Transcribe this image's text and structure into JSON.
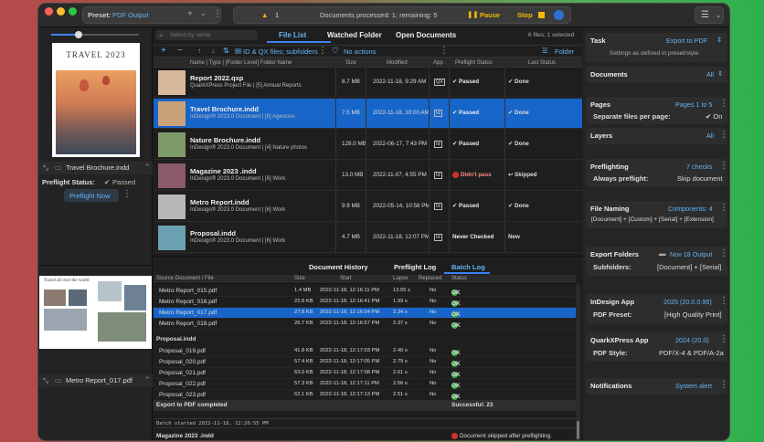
{
  "toolbar": {
    "preset_label": "Preset:",
    "preset_value": "PDF Output",
    "warning_count": "1",
    "status": "Documents processed: 1; remaining: 5",
    "pause": "Pause",
    "stop": "Stop"
  },
  "left": {
    "doc1": "Travel Brochure.indd",
    "thumb_title": "TRAVEL 2023",
    "preflight_label": "Preflight Status:",
    "preflight_value": "Passed",
    "preflight_now": "Preflight Now",
    "doc2": "Metro Report_017.pdf",
    "thumb2_title": "Travel all over the world"
  },
  "tabs": {
    "file_list": "File List",
    "watched": "Watched Folder",
    "open_docs": "Open Documents"
  },
  "list": {
    "search_placeholder": "Select by name",
    "count": "6 files; 1 selected",
    "filter": "ID & QX files; subfolders",
    "actions": "No actions",
    "sort": "Folder Name",
    "headers": [
      "Folder Level",
      "Size",
      "Modified",
      "App",
      "Preflight Status",
      "Last Status"
    ],
    "header_name": "Name | Type | [Folder Level] Folder Name",
    "files": [
      {
        "name": "Report 2022.qxp",
        "sub": "QuarkXPress Project File | [5] Annual Reports",
        "size": "8.7 MB",
        "modified": "2022-11-18, 9:29 AM",
        "app": "QX",
        "preflight": "✔ Passed",
        "last": "✔ Done"
      },
      {
        "name": "Travel Brochure.indd",
        "sub": "InDesign® 2023.0 Document | [6] Agencies",
        "size": "7.5 MB",
        "modified": "2022-11-18, 10:00 AM",
        "app": "Id",
        "preflight": "✔ Passed",
        "last": "✔ Done"
      },
      {
        "name": "Nature Brochure.indd",
        "sub": "InDesign® 2023.0 Document | [4] Nature photos",
        "size": "128.0 MB",
        "modified": "2022-06-17, 7:43 PM",
        "app": "Id",
        "preflight": "✔ Passed",
        "last": "✔ Done"
      },
      {
        "name": "Magazine 2023 .indd",
        "sub": "InDesign® 2023.0 Document | [6] Work",
        "size": "13.0 MB",
        "modified": "2022-11-07, 4:55 PM",
        "app": "Id",
        "preflight": "Didn't pass",
        "last": "↩ Skipped"
      },
      {
        "name": "Metro Report.indd",
        "sub": "InDesign® 2023.0 Document | [6] Work",
        "size": "9.9 MB",
        "modified": "2022-05-14, 10:58 PM",
        "app": "Id",
        "preflight": "✔ Passed",
        "last": "✔ Done"
      },
      {
        "name": "Proposal.indd",
        "sub": "InDesign® 2023.0 Document | [6] Work",
        "size": "4.7 MB",
        "modified": "2022-11-18, 12:07 PM",
        "app": "Id",
        "preflight": "Never Checked",
        "last": "New"
      }
    ]
  },
  "logtabs": {
    "history": "Document History",
    "preflight": "Preflight Log",
    "batch": "Batch Log"
  },
  "batch": {
    "headers": [
      "Source Document / File",
      "Size",
      "Start",
      "Lapse",
      "Replaced",
      "Status"
    ],
    "rows1": [
      {
        "file": "Metro Report_015.pdf",
        "size": "1.4 MB",
        "start": "2022-11-18, 12:16:11 PM",
        "lapse": "13.55 s",
        "replaced": "No",
        "status": "OK"
      },
      {
        "file": "Metro Report_016.pdf",
        "size": "22.8 KB",
        "start": "2022-11-18, 12:16:41 PM",
        "lapse": "1.93 s",
        "replaced": "No",
        "status": "OK"
      },
      {
        "file": "Metro Report_017.pdf",
        "size": "27.8 KB",
        "start": "2022-11-18, 12:16:54 PM",
        "lapse": "2.34 s",
        "replaced": "No",
        "status": "OK"
      },
      {
        "file": "Metro Report_018.pdf",
        "size": "26.7 KB",
        "start": "2022-11-18, 12:16:57 PM",
        "lapse": "2.37 s",
        "replaced": "No",
        "status": "OK"
      }
    ],
    "group": "Proposal.indd",
    "rows2": [
      {
        "file": "Proposal_019.pdf",
        "size": "41.8 KB",
        "start": "2022-11-18, 12:17:03 PM",
        "lapse": "2.40 s",
        "replaced": "No",
        "status": "OK"
      },
      {
        "file": "Proposal_020.pdf",
        "size": "57.4 KB",
        "start": "2022-11-18, 12:17:05 PM",
        "lapse": "2.79 s",
        "replaced": "No",
        "status": "OK"
      },
      {
        "file": "Proposal_021.pdf",
        "size": "63.0 KB",
        "start": "2022-11-18, 12:17:08 PM",
        "lapse": "2.61 s",
        "replaced": "No",
        "status": "OK"
      },
      {
        "file": "Proposal_022.pdf",
        "size": "57.3 KB",
        "start": "2022-11-18, 12:17:11 PM",
        "lapse": "2.56 s",
        "replaced": "No",
        "status": "OK"
      },
      {
        "file": "Proposal_023.pdf",
        "size": "62.1 KB",
        "start": "2022-11-18, 12:17:13 PM",
        "lapse": "2.51 s",
        "replaced": "No",
        "status": "OK"
      }
    ],
    "completed": "Export to PDF completed",
    "successful": "Successful: 23",
    "started": "Batch started 2022-11-18, 12:20:55 PM",
    "last_doc": "Magazine 2023 .indd",
    "last_msg": "Document skipped after preflighting."
  },
  "right": {
    "task_label": "Task",
    "task_value": "Export to PDF",
    "task_desc": "Settings as defined in preset/style",
    "documents_label": "Documents",
    "documents_value": "All",
    "pages_label": "Pages",
    "pages_value": "Pages 1 to 5",
    "sep_label": "Separate files per page:",
    "sep_value": "✔ On",
    "layers_label": "Layers",
    "layers_value": "All",
    "preflight_label": "Preflighting",
    "preflight_value": "7 checks",
    "always_label": "Always preflight:",
    "always_value": "Skip document",
    "naming_label": "File Naming",
    "naming_value": "Components: 4",
    "naming_desc": "[Document] + [Custom] + [Serial] + [Extension]",
    "export_label": "Export Folders",
    "export_value": "Nov 18 Output",
    "subfolders_label": "Subfolders:",
    "subfolders_value": "[Document] + [Serial]",
    "indesign_label": "InDesign App",
    "indesign_value": "2025 (20.0.0.95)",
    "pdfpreset_label": "PDF Preset:",
    "pdfpreset_value": "[High Quality Print]",
    "quark_label": "QuarkXPress App",
    "quark_value": "2024 (20.0)",
    "pdfstyle_label": "PDF Style:",
    "pdfstyle_value": "PDF/X-4 & PDF/A-2a",
    "notif_label": "Notifications",
    "notif_value": "System alert"
  }
}
